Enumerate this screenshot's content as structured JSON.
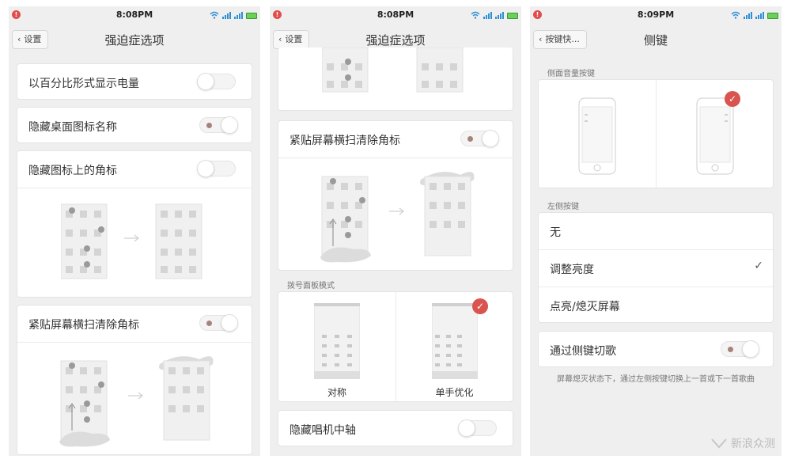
{
  "screen1": {
    "status": {
      "time": "8:08PM"
    },
    "nav": {
      "back_label": "设置",
      "title": "强迫症选项"
    },
    "rows": {
      "percent_battery": "以百分比形式显示电量",
      "hide_icon_names": "隐藏桌面图标名称",
      "hide_badges": "隐藏图标上的角标",
      "swipe_clear": "紧贴屏幕横扫清除角标"
    },
    "toggles": {
      "percent_battery": false,
      "hide_icon_names": true,
      "hide_badges": false,
      "swipe_clear": true
    }
  },
  "screen2": {
    "status": {
      "time": "8:08PM"
    },
    "nav": {
      "back_label": "设置",
      "title": "强迫症选项"
    },
    "rows": {
      "swipe_clear": "紧贴屏幕横扫清除角标",
      "dial_section": "拨号面板模式",
      "dial_symmetric": "对称",
      "dial_onehand": "单手优化",
      "hide_album_axis": "隐藏唱机中轴"
    },
    "toggles": {
      "swipe_clear": true,
      "hide_album_axis": false
    }
  },
  "screen3": {
    "status": {
      "time": "8:09PM"
    },
    "nav": {
      "back_label": "按键快...",
      "title": "侧键"
    },
    "rows": {
      "volume_section": "侧面音量按键",
      "left_section": "左侧按键",
      "opt_none": "无",
      "opt_brightness": "调整亮度",
      "opt_screen": "点亮/熄灭屏幕",
      "switch_song": "通过侧键切歌",
      "note": "屏幕熄灭状态下，通过左侧按键切换上一首或下一首歌曲"
    },
    "selected_option": "调整亮度",
    "toggles": {
      "switch_song": true
    }
  },
  "watermark": "新浪众测",
  "colors": {
    "accent_red": "#d9534f",
    "toggle_dot": "#a5837a"
  }
}
